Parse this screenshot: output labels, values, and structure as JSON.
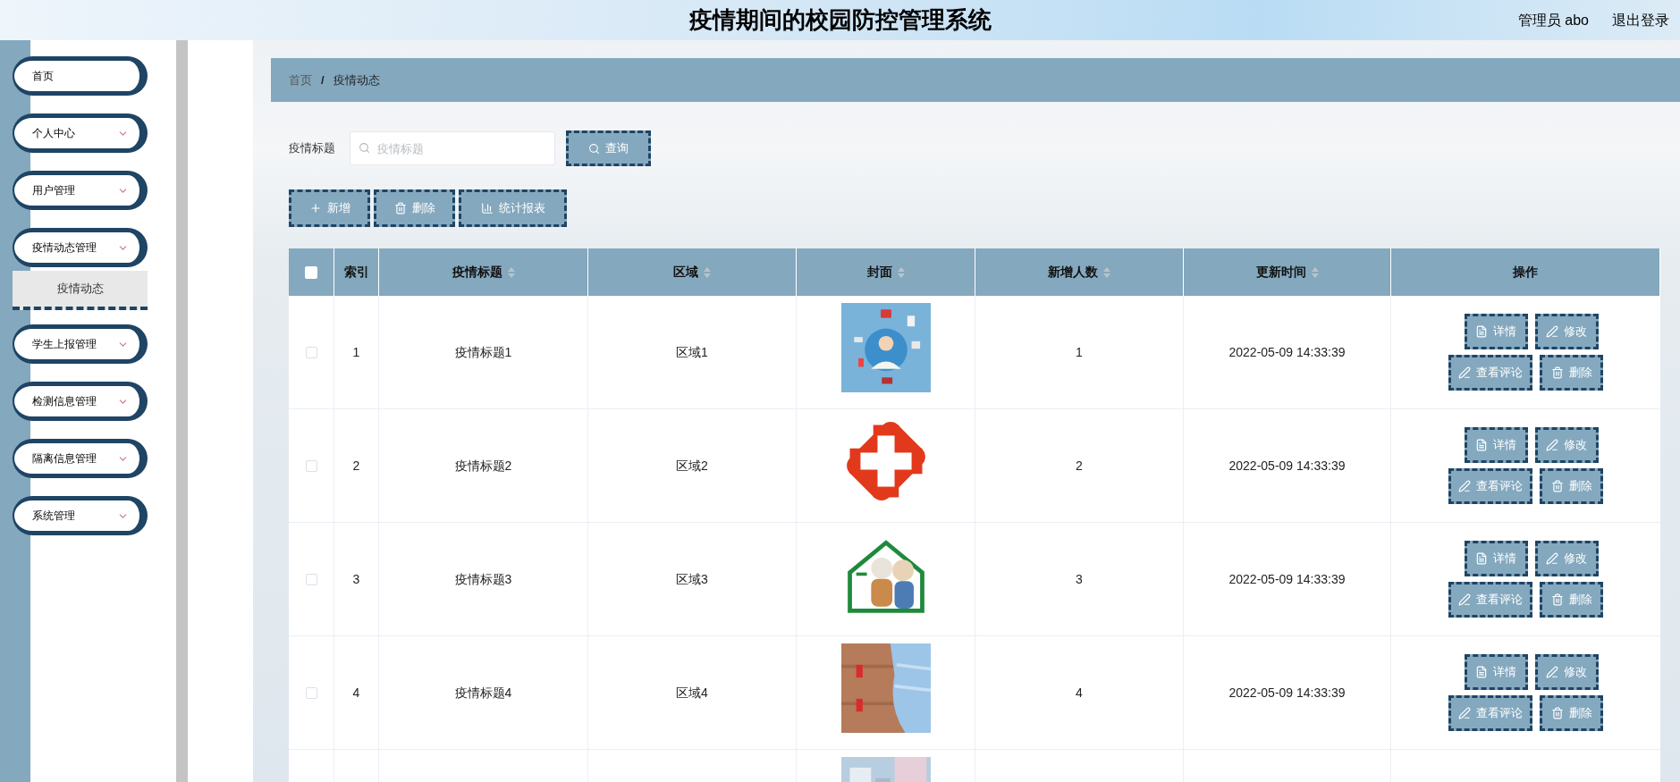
{
  "header": {
    "title": "疫情期间的校园防控管理系统",
    "user": "管理员 abo",
    "logout": "退出登录"
  },
  "sidebar": {
    "items": [
      {
        "label": "首页",
        "kind": "link"
      },
      {
        "label": "个人中心",
        "kind": "menu"
      },
      {
        "label": "用户管理",
        "kind": "menu"
      },
      {
        "label": "疫情动态管理",
        "kind": "menu",
        "children": [
          {
            "label": "疫情动态",
            "selected": true
          }
        ]
      },
      {
        "label": "学生上报管理",
        "kind": "menu"
      },
      {
        "label": "检测信息管理",
        "kind": "menu"
      },
      {
        "label": "隔离信息管理",
        "kind": "menu"
      },
      {
        "label": "系统管理",
        "kind": "menu"
      }
    ]
  },
  "breadcrumb": {
    "items": [
      "首页",
      "疫情动态"
    ],
    "separator": "/"
  },
  "search": {
    "label": "疫情标题",
    "placeholder": "疫情标题",
    "button": "查询"
  },
  "toolbar": [
    {
      "label": "新增",
      "kind": "add"
    },
    {
      "label": "删除",
      "kind": "delete"
    },
    {
      "label": "统计报表",
      "kind": "chart"
    }
  ],
  "table": {
    "columns": [
      {
        "kind": "checkbox",
        "checked": false
      },
      {
        "kind": "text",
        "label": "索引",
        "sortable": false
      },
      {
        "kind": "text",
        "label": "疫情标题",
        "sortable": true
      },
      {
        "kind": "text",
        "label": "区域",
        "sortable": true
      },
      {
        "kind": "text",
        "label": "封面",
        "sortable": true
      },
      {
        "kind": "text",
        "label": "新增人数",
        "sortable": true
      },
      {
        "kind": "text",
        "label": "更新时间",
        "sortable": true
      },
      {
        "kind": "text",
        "label": "操作",
        "sortable": false
      }
    ],
    "rows": [
      {
        "checked": false,
        "index": "1",
        "title": "疫情标题1",
        "region": "区域1",
        "cover": {
          "kind": "picture"
        },
        "count": "1",
        "time": "2022-05-09 14:33:39",
        "actions": [
          {
            "label": "详情",
            "kind": "detail"
          },
          {
            "label": "修改",
            "kind": "edit"
          },
          {
            "label": "查看评论",
            "kind": "comments"
          },
          {
            "label": "删除",
            "kind": "delete"
          }
        ]
      },
      {
        "checked": false,
        "index": "2",
        "title": "疫情标题2",
        "region": "区域2",
        "cover": {
          "kind": "picture"
        },
        "count": "2",
        "time": "2022-05-09 14:33:39",
        "actions": [
          {
            "label": "详情",
            "kind": "detail"
          },
          {
            "label": "修改",
            "kind": "edit"
          },
          {
            "label": "查看评论",
            "kind": "comments"
          },
          {
            "label": "删除",
            "kind": "delete"
          }
        ]
      },
      {
        "checked": false,
        "index": "3",
        "title": "疫情标题3",
        "region": "区域3",
        "cover": {
          "kind": "picture"
        },
        "count": "3",
        "time": "2022-05-09 14:33:39",
        "actions": [
          {
            "label": "详情",
            "kind": "detail"
          },
          {
            "label": "修改",
            "kind": "edit"
          },
          {
            "label": "查看评论",
            "kind": "comments"
          },
          {
            "label": "删除",
            "kind": "delete"
          }
        ]
      },
      {
        "checked": false,
        "index": "4",
        "title": "疫情标题4",
        "region": "区域4",
        "cover": {
          "kind": "picture"
        },
        "count": "4",
        "time": "2022-05-09 14:33:39",
        "actions": [
          {
            "label": "详情",
            "kind": "detail"
          },
          {
            "label": "修改",
            "kind": "edit"
          },
          {
            "label": "查看评论",
            "kind": "comments"
          },
          {
            "label": "删除",
            "kind": "delete"
          }
        ]
      },
      {
        "cover": {
          "kind": "picture"
        }
      }
    ]
  }
}
